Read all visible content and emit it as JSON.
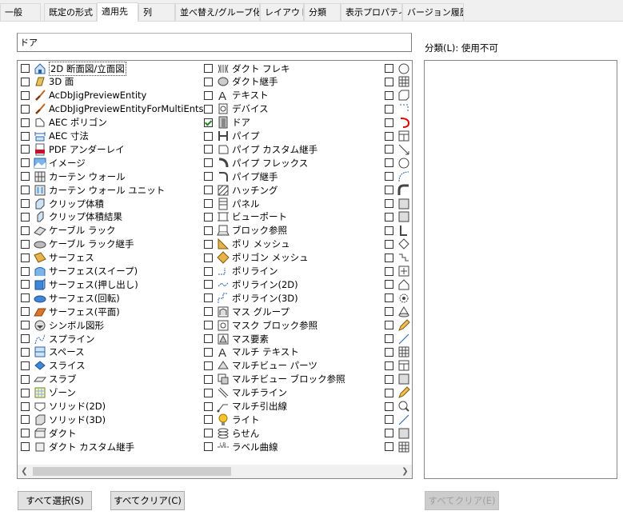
{
  "tabs": [
    {
      "label": "一般"
    },
    {
      "label": "既定の形式"
    },
    {
      "label": "適用先",
      "active": true
    },
    {
      "label": "列"
    },
    {
      "label": "並べ替え/グループ化"
    },
    {
      "label": "レイアウト"
    },
    {
      "label": "分類"
    },
    {
      "label": "表示プロパティ"
    },
    {
      "label": "バージョン履歴"
    }
  ],
  "filter": {
    "value": "ドア"
  },
  "list": {
    "columns": [
      [
        {
          "label": "2D 断面図/立面図",
          "icon": "section-icon",
          "checked": false,
          "focused": true
        },
        {
          "label": "3D 面",
          "icon": "3d-face-icon",
          "checked": false
        },
        {
          "label": "AcDbJigPreviewEntity",
          "icon": "brush-icon",
          "checked": false
        },
        {
          "label": "AcDbJigPreviewEntityForMultiEnts",
          "icon": "brush-icon",
          "checked": false
        },
        {
          "label": "AEC ポリゴン",
          "icon": "polygon-icon",
          "checked": false
        },
        {
          "label": "AEC 寸法",
          "icon": "dimension-icon",
          "checked": false
        },
        {
          "label": "PDF アンダーレイ",
          "icon": "pdf-icon",
          "checked": false
        },
        {
          "label": "イメージ",
          "icon": "image-icon",
          "checked": false
        },
        {
          "label": "カーテン ウォール",
          "icon": "curtain-wall-icon",
          "checked": false
        },
        {
          "label": "カーテン ウォール ユニット",
          "icon": "curtain-wall-unit-icon",
          "checked": false
        },
        {
          "label": "クリップ体積",
          "icon": "clip-volume-icon",
          "checked": false
        },
        {
          "label": "クリップ体積結果",
          "icon": "clip-volume-result-icon",
          "checked": false
        },
        {
          "label": "ケーブル ラック",
          "icon": "cable-tray-icon",
          "checked": false
        },
        {
          "label": "ケーブル ラック継手",
          "icon": "cable-tray-fitting-icon",
          "checked": false
        },
        {
          "label": "サーフェス",
          "icon": "surface-icon",
          "checked": false
        },
        {
          "label": "サーフェス(スイープ)",
          "icon": "surface-sweep-icon",
          "checked": false
        },
        {
          "label": "サーフェス(押し出し)",
          "icon": "surface-extrude-icon",
          "checked": false
        },
        {
          "label": "サーフェス(回転)",
          "icon": "surface-revolve-icon",
          "checked": false
        },
        {
          "label": "サーフェス(平面)",
          "icon": "surface-planar-icon",
          "checked": false
        },
        {
          "label": "シンボル図形",
          "icon": "symbol-icon",
          "checked": false
        },
        {
          "label": "スプライン",
          "icon": "spline-icon",
          "checked": false
        },
        {
          "label": "スペース",
          "icon": "space-icon",
          "checked": false
        },
        {
          "label": "スライス",
          "icon": "slice-icon",
          "checked": false
        },
        {
          "label": "スラブ",
          "icon": "slab-icon",
          "checked": false
        },
        {
          "label": "ゾーン",
          "icon": "zone-icon",
          "checked": false
        },
        {
          "label": "ソリッド(2D)",
          "icon": "solid-2d-icon",
          "checked": false
        },
        {
          "label": "ソリッド(3D)",
          "icon": "solid-3d-icon",
          "checked": false
        },
        {
          "label": "ダクト",
          "icon": "duct-icon",
          "checked": false
        },
        {
          "label": "ダクト カスタム継手",
          "icon": "duct-custom-fitting-icon",
          "checked": false
        }
      ],
      [
        {
          "label": "ダクト フレキ",
          "icon": "duct-flex-icon",
          "checked": false
        },
        {
          "label": "ダクト継手",
          "icon": "duct-fitting-icon",
          "checked": false
        },
        {
          "label": "テキスト",
          "icon": "text-icon",
          "checked": false
        },
        {
          "label": "デバイス",
          "icon": "device-icon",
          "checked": false
        },
        {
          "label": "ドア",
          "icon": "door-icon",
          "checked": true
        },
        {
          "label": "パイプ",
          "icon": "pipe-icon",
          "checked": false
        },
        {
          "label": "パイプ カスタム継手",
          "icon": "pipe-custom-fitting-icon",
          "checked": false
        },
        {
          "label": "パイプ フレックス",
          "icon": "pipe-flex-icon",
          "checked": false
        },
        {
          "label": "パイプ継手",
          "icon": "pipe-fitting-icon",
          "checked": false
        },
        {
          "label": "ハッチング",
          "icon": "hatch-icon",
          "checked": false
        },
        {
          "label": "パネル",
          "icon": "panel-icon",
          "checked": false
        },
        {
          "label": "ビューポート",
          "icon": "viewport-icon",
          "checked": false
        },
        {
          "label": "ブロック参照",
          "icon": "block-reference-icon",
          "checked": false
        },
        {
          "label": "ポリ メッシュ",
          "icon": "poly-mesh-icon",
          "checked": false
        },
        {
          "label": "ポリゴン メッシュ",
          "icon": "polygon-mesh-icon",
          "checked": false
        },
        {
          "label": "ポリライン",
          "icon": "polyline-icon",
          "checked": false
        },
        {
          "label": "ポリライン(2D)",
          "icon": "polyline-2d-icon",
          "checked": false
        },
        {
          "label": "ポリライン(3D)",
          "icon": "polyline-3d-icon",
          "checked": false
        },
        {
          "label": "マス グループ",
          "icon": "mass-group-icon",
          "checked": false
        },
        {
          "label": "マスク ブロック参照",
          "icon": "mask-block-icon",
          "checked": false
        },
        {
          "label": "マス要素",
          "icon": "mass-element-icon",
          "checked": false
        },
        {
          "label": "マルチ テキスト",
          "icon": "mtext-icon",
          "checked": false
        },
        {
          "label": "マルチビュー パーツ",
          "icon": "multiview-part-icon",
          "checked": false
        },
        {
          "label": "マルチビュー ブロック参照",
          "icon": "multiview-block-icon",
          "checked": false
        },
        {
          "label": "マルチライン",
          "icon": "mline-icon",
          "checked": false
        },
        {
          "label": "マルチ引出線",
          "icon": "mleader-icon",
          "checked": false
        },
        {
          "label": "ライト",
          "icon": "light-icon",
          "checked": false
        },
        {
          "label": "らせん",
          "icon": "helix-icon",
          "checked": false
        },
        {
          "label": "ラベル曲線",
          "icon": "label-curve-icon",
          "checked": false
        }
      ],
      [
        {
          "label": "",
          "icon": "circle-icon",
          "checked": false
        },
        {
          "label": "",
          "icon": "grid-icon",
          "checked": false
        },
        {
          "label": "",
          "icon": "box-icon",
          "checked": false
        },
        {
          "label": "",
          "icon": "dashed-icon",
          "checked": false
        },
        {
          "label": "",
          "icon": "arc-red-icon",
          "checked": false
        },
        {
          "label": "",
          "icon": "table-icon",
          "checked": false
        },
        {
          "label": "",
          "icon": "arrow-icon",
          "checked": false
        },
        {
          "label": "",
          "icon": "circle-icon",
          "checked": false
        },
        {
          "label": "",
          "icon": "curve-icon",
          "checked": false
        },
        {
          "label": "",
          "icon": "elbow-icon",
          "checked": false
        },
        {
          "label": "",
          "icon": "square-icon",
          "checked": false
        },
        {
          "label": "",
          "icon": "square-icon",
          "checked": false
        },
        {
          "label": "",
          "icon": "bracket-icon",
          "checked": false
        },
        {
          "label": "",
          "icon": "diamond-icon",
          "checked": false
        },
        {
          "label": "",
          "icon": "step-icon",
          "checked": false
        },
        {
          "label": "",
          "icon": "plus-box-icon",
          "checked": false
        },
        {
          "label": "",
          "icon": "house-icon",
          "checked": false
        },
        {
          "label": "",
          "icon": "gear-icon",
          "checked": false
        },
        {
          "label": "",
          "icon": "cone-icon",
          "checked": false
        },
        {
          "label": "",
          "icon": "pencil-icon",
          "checked": false
        },
        {
          "label": "",
          "icon": "line-icon",
          "checked": false
        },
        {
          "label": "",
          "icon": "grid-icon",
          "checked": false
        },
        {
          "label": "",
          "icon": "table-icon",
          "checked": false
        },
        {
          "label": "",
          "icon": "square-icon",
          "checked": false
        },
        {
          "label": "",
          "icon": "pencil-icon",
          "checked": false
        },
        {
          "label": "",
          "icon": "magnifier-icon",
          "checked": false
        },
        {
          "label": "",
          "icon": "line-icon",
          "checked": false
        },
        {
          "label": "",
          "icon": "square-icon",
          "checked": false
        },
        {
          "label": "",
          "icon": "grid-icon",
          "checked": false
        }
      ]
    ]
  },
  "category": {
    "label": "分類(L): 使用不可"
  },
  "buttons": {
    "select_all": "すべて選択(S)",
    "clear_all": "すべてクリア(C)",
    "clear_all_category": "すべてクリア(E)"
  }
}
